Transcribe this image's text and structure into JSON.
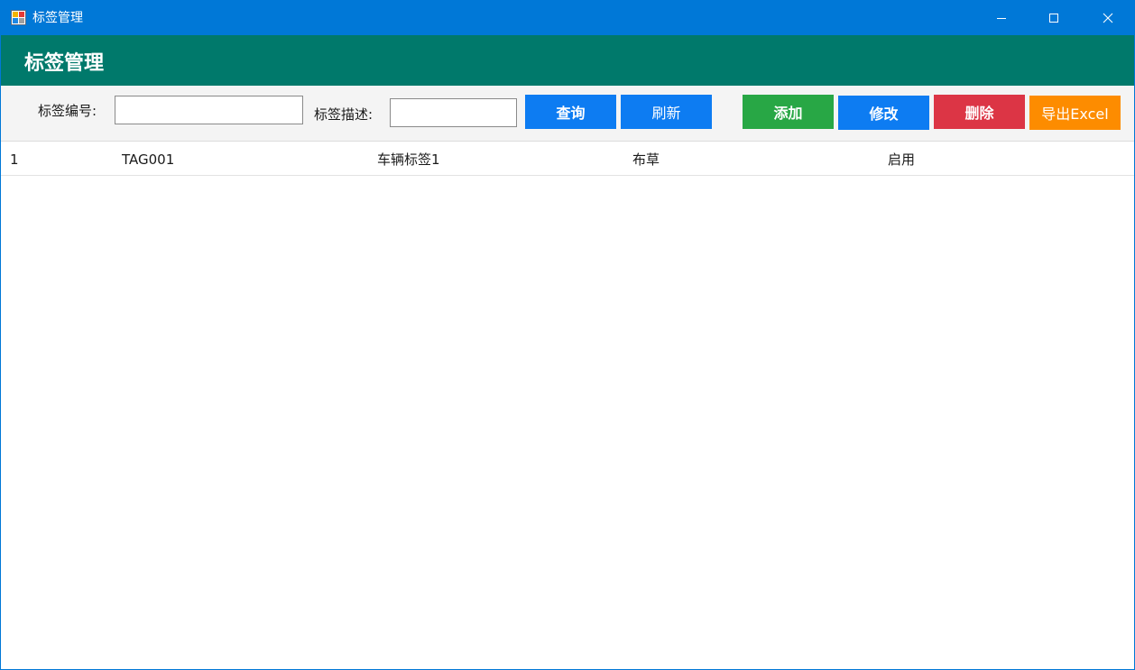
{
  "window": {
    "title": "标签管理",
    "controls": {
      "minimize_icon": "minimize-icon",
      "maximize_icon": "maximize-icon",
      "close_icon": "close-icon"
    }
  },
  "header": {
    "title": "标签管理"
  },
  "toolbar": {
    "code_label": "标签编号:",
    "code_value": "",
    "desc_label": "标签描述:",
    "desc_value": "",
    "query_label": "查询",
    "refresh_label": "刷新",
    "add_label": "添加",
    "edit_label": "修改",
    "delete_label": "删除",
    "export_label": "导出Excel"
  },
  "grid": {
    "rows": [
      {
        "cells": [
          "1",
          "TAG001",
          "车辆标签1",
          "布草",
          "启用"
        ]
      }
    ]
  },
  "colors": {
    "titlebar": "#0078d7",
    "header": "#00796b",
    "primary_button": "#0d7cf2",
    "add_button": "#28a745",
    "delete_button": "#dc3545",
    "export_button": "#fd8c00"
  }
}
